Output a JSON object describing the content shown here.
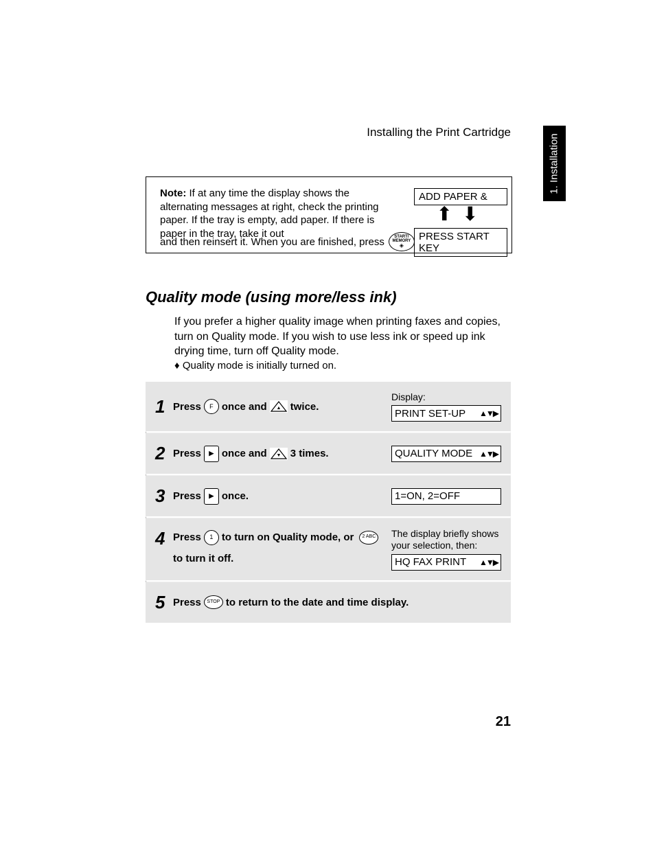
{
  "runningHead": "Installing the Print Cartridge",
  "sideTab": "1. Installation",
  "note": {
    "label": "Note:",
    "body": "If at any time the display shows the alternating messages at right, check the printing paper. If the tray is empty, add paper. If there is paper in the tray, take it out",
    "line2a": "and then reinsert it. When you are finished, press",
    "line2b": ".",
    "startMemTop": "START/",
    "startMemMid": "MEMORY",
    "disp1": "ADD PAPER &",
    "disp2": "PRESS START KEY"
  },
  "section": {
    "title": "Quality mode (using more/less ink)",
    "intro": "If you prefer a higher quality image when printing faxes and copies, turn on Quality mode. If you wish to use less ink or speed up ink drying time, turn off Quality mode.",
    "bullet": "♦  Quality mode is initially turned on."
  },
  "steps": {
    "displayLabel": "Display:",
    "s1": {
      "num": "1",
      "a": "Press",
      "b": "once and",
      "c": "twice.",
      "lcd": "PRINT SET-UP"
    },
    "s2": {
      "num": "2",
      "a": "Press",
      "b": "once and",
      "c": "3 times.",
      "lcd": "QUALITY MODE"
    },
    "s3": {
      "num": "3",
      "a": "Press",
      "b": "once.",
      "lcd": "1=ON, 2=OFF"
    },
    "s4": {
      "num": "4",
      "a": "Press",
      "b": "to turn on Quality mode, or",
      "c": "to turn it off.",
      "hint": "The display briefly shows your selection, then:",
      "lcd": "HQ FAX PRINT"
    },
    "s5": {
      "num": "5",
      "a": "Press",
      "b": "to return to the date and time display."
    }
  },
  "keys": {
    "f": "F",
    "one": "1",
    "two": "2 ABC",
    "stop": "STOP",
    "nav": "▲▼▶",
    "arrow": "▶"
  },
  "pageNumber": "21"
}
